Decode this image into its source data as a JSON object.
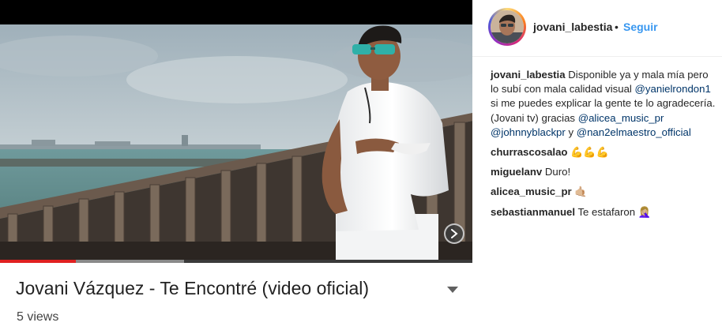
{
  "video": {
    "title": "Jovani Vázquez - Te Encontré (video oficial)",
    "views": "5 views",
    "progress_played": 0.16,
    "progress_buffered": 0.39,
    "next_icon": "chevron-right-icon",
    "dropdown_icon": "caret-down-icon"
  },
  "post": {
    "username": "jovani_labestia",
    "separator": "•",
    "follow_label": "Seguir"
  },
  "caption": {
    "username": "jovani_labestia",
    "text_1": "Disponible ya y mala mía pero lo subí con mala calidad visual",
    "mention_1": "@yanielrondon1",
    "text_2": "si me puedes explicar la gente te lo agradecería. (Jovani tv) gracias",
    "mention_2": "@alicea_music_pr",
    "mention_3": "@johnnyblackpr",
    "text_3": "y",
    "mention_4": "@nan2elmaestro_official"
  },
  "comments": [
    {
      "username": "churrascosalao",
      "text": "💪💪💪"
    },
    {
      "username": "miguelanv",
      "text": "Duro!"
    },
    {
      "username": "alicea_music_pr",
      "text": "🤙🏼"
    },
    {
      "username": "sebastianmanuel",
      "text": "Te estafaron 🤦🏼‍♀️"
    }
  ],
  "colors": {
    "link_blue": "#3897f0",
    "mention_blue": "#003569",
    "progress_red": "#e02020"
  }
}
